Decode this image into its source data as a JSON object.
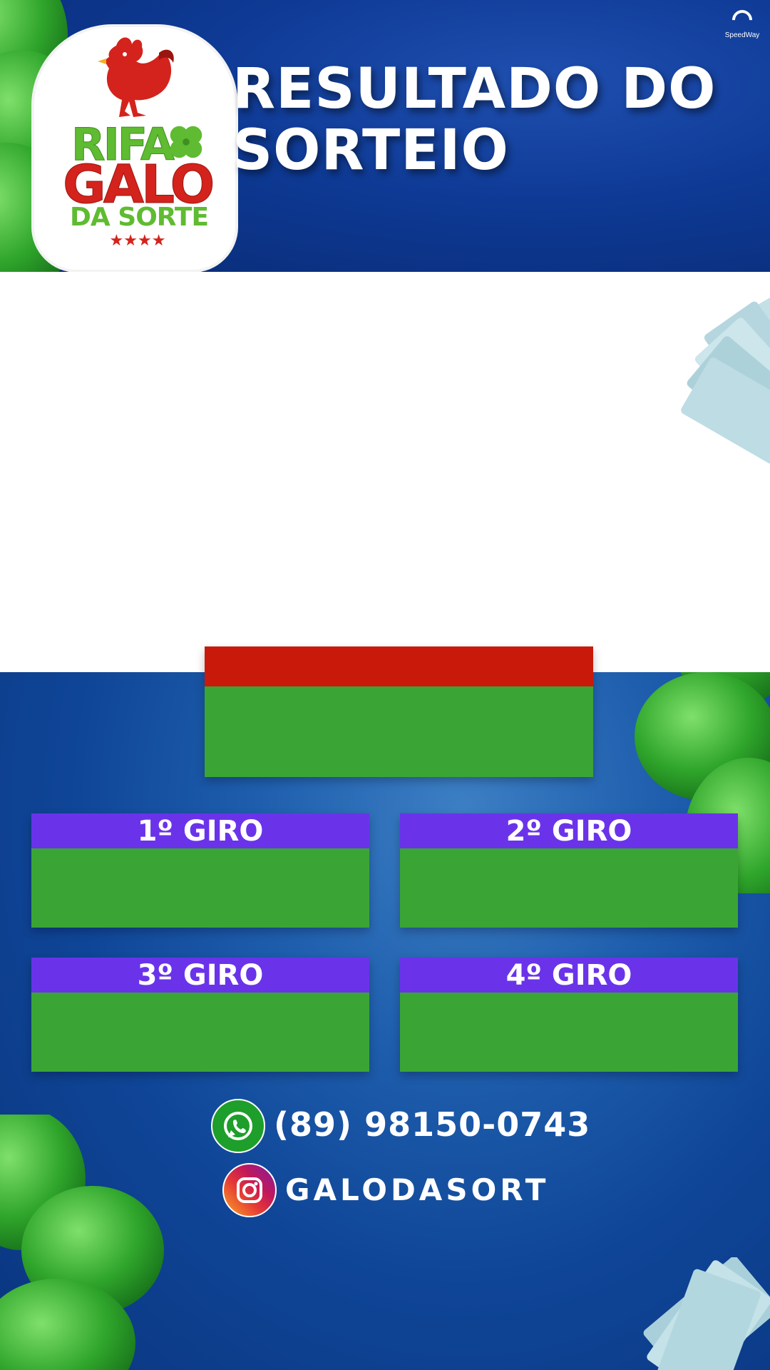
{
  "header": {
    "title_line1": "RESULTADO DO",
    "title_line2": "SORTEIO",
    "watermark": "SpeedWay"
  },
  "logo": {
    "line1": "RIFA",
    "line2": "GALO",
    "line3": "DA SORTE",
    "stars": "★★★★"
  },
  "giros": [
    {
      "label": "1º GIRO"
    },
    {
      "label": "2º GIRO"
    },
    {
      "label": "3º GIRO"
    },
    {
      "label": "4º GIRO"
    }
  ],
  "contacts": {
    "phone": "(89) 98150-0743",
    "instagram": "GALODASORT"
  },
  "colors": {
    "header_blue": "#0e3a95",
    "result_red": "#c9190a",
    "result_green": "#3aa535",
    "giro_purple": "#6a33ea"
  },
  "icons": [
    "rooster-icon",
    "clover-icon",
    "whatsapp-icon",
    "instagram-icon",
    "money-bills"
  ]
}
